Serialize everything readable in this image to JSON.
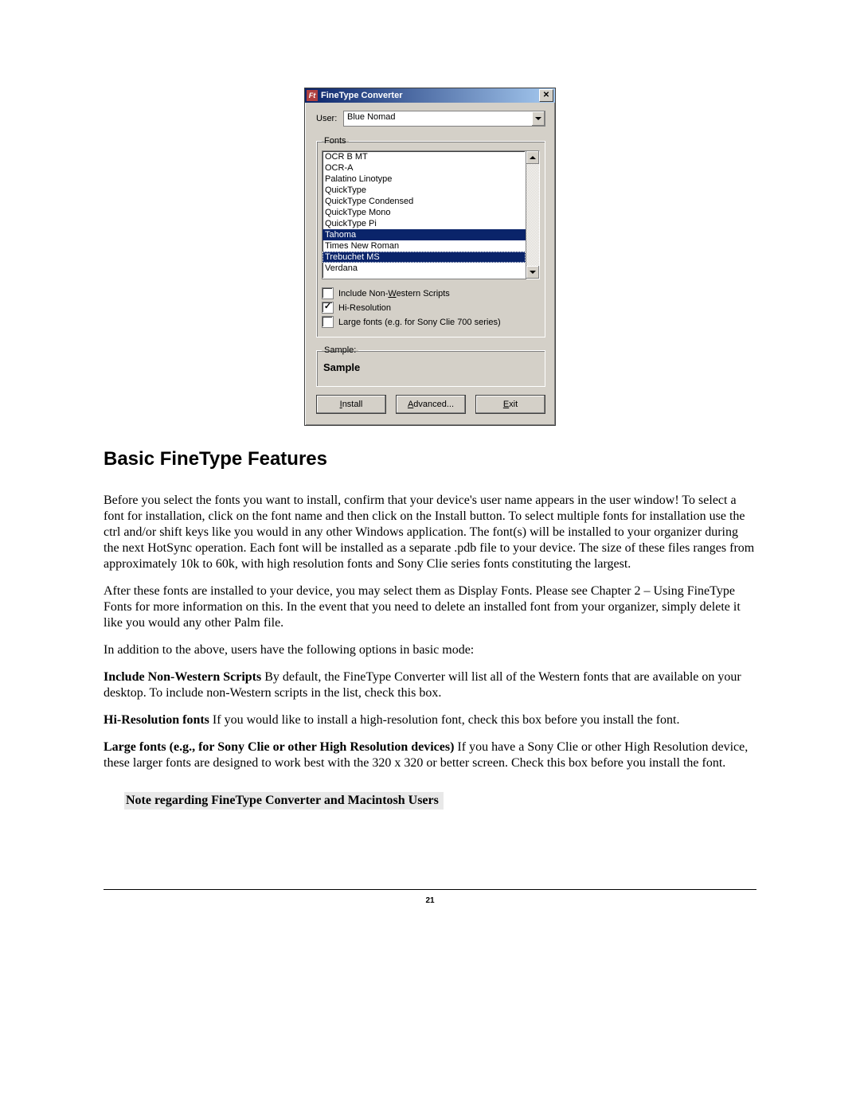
{
  "dialog": {
    "title": "FineType Converter",
    "icon_glyph": "Ft",
    "user_label": "User:",
    "user_value": "Blue Nomad",
    "fonts_label": "Fonts",
    "fonts": [
      "OCR B MT",
      "OCR-A",
      "Palatino Linotype",
      "QuickType",
      "QuickType Condensed",
      "QuickType Mono",
      "QuickType Pi",
      "Tahoma",
      "Times New Roman",
      "Trebuchet MS",
      "Verdana"
    ],
    "selected_indices": [
      7,
      9
    ],
    "focus_index": 9,
    "checkboxes": [
      {
        "label_pre": "Include Non-",
        "label_u": "W",
        "label_post": "estern Scripts",
        "checked": false
      },
      {
        "label_pre": "Hi-Resolution",
        "label_u": "",
        "label_post": "",
        "checked": true
      },
      {
        "label_pre": "Large fonts (e.g. for Sony Clie 700 series)",
        "label_u": "",
        "label_post": "",
        "checked": false
      }
    ],
    "sample_label": "Sample:",
    "sample_text": "Sample",
    "buttons": {
      "install": {
        "u": "I",
        "rest": "nstall"
      },
      "advanced": {
        "u": "A",
        "rest": "dvanced..."
      },
      "exit": {
        "u": "E",
        "rest": "xit"
      }
    }
  },
  "doc": {
    "heading": "Basic FineType Features",
    "p1": "Before you select the fonts you want to install, confirm that your device's user name appears in the user window! To select a font for installation, click on the font name and then click on the Install button.  To select multiple fonts for installation use the ctrl and/or shift keys like you would in any other Windows application. The font(s) will be installed to your organizer during the next HotSync operation.  Each font will be installed as a separate .pdb file to your device.  The size of these files ranges from approximately 10k to 60k, with high resolution fonts and Sony Clie series fonts constituting the largest.",
    "p2": "After these fonts are installed to your device, you may select them as Display Fonts.  Please see Chapter 2 – Using FineType Fonts for more information on this.  In the event that you need to delete an installed font from your organizer, simply delete it like you would any other Palm file.",
    "p3": "In addition to the above, users have the following options in basic mode:",
    "p4_bold": "Include Non-Western Scripts",
    "p4_rest": " By default, the FineType Converter will list all of the Western fonts that are available on your desktop.  To include non-Western scripts in the list, check this box.",
    "p5_bold": "Hi-Resolution fonts",
    "p5_rest": " If you would like to install a high-resolution font, check this box before you install the font.",
    "p6_bold": "Large fonts (e.g., for Sony Clie or other High Resolution devices)",
    "p6_rest": " If you have a Sony Clie or other High Resolution device, these larger fonts are designed to work best with the 320 x 320 or better screen.  Check this box before you install the font.",
    "note_title": "Note regarding FineType Converter and Macintosh Users",
    "page_number": "21"
  }
}
